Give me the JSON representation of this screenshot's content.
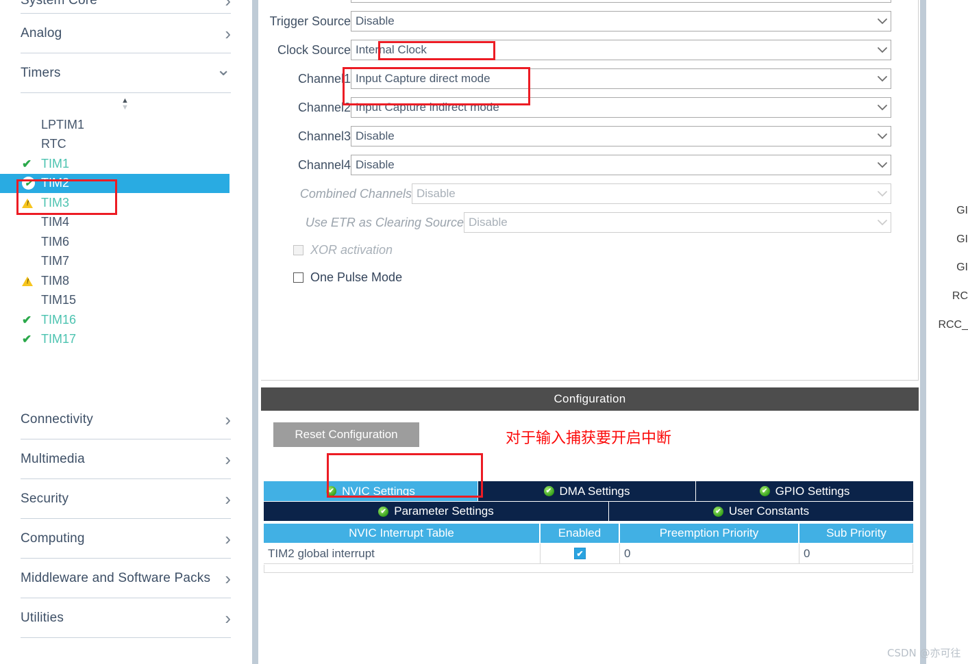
{
  "sidebar": {
    "categories_top": [
      {
        "label": "System Core",
        "icon": "chevron-right-icon",
        "expanded": false
      },
      {
        "label": "Analog",
        "icon": "chevron-right-icon",
        "expanded": false
      },
      {
        "label": "Timers",
        "icon": "chevron-down-icon",
        "expanded": true
      }
    ],
    "scroll_spinner": {
      "up": "▲",
      "down": "▼"
    },
    "timers": [
      {
        "label": "LPTIM1",
        "status": "none"
      },
      {
        "label": "RTC",
        "status": "none"
      },
      {
        "label": "TIM1",
        "status": "check"
      },
      {
        "label": "TIM2",
        "status": "circle-check",
        "selected": true
      },
      {
        "label": "TIM3",
        "status": "warning"
      },
      {
        "label": "TIM4",
        "status": "none"
      },
      {
        "label": "TIM6",
        "status": "none"
      },
      {
        "label": "TIM7",
        "status": "none"
      },
      {
        "label": "TIM8",
        "status": "warning"
      },
      {
        "label": "TIM15",
        "status": "none"
      },
      {
        "label": "TIM16",
        "status": "check"
      },
      {
        "label": "TIM17",
        "status": "check"
      }
    ],
    "categories_bottom": [
      {
        "label": "Connectivity",
        "icon": "chevron-right-icon"
      },
      {
        "label": "Multimedia",
        "icon": "chevron-right-icon"
      },
      {
        "label": "Security",
        "icon": "chevron-right-icon"
      },
      {
        "label": "Computing",
        "icon": "chevron-right-icon"
      },
      {
        "label": "Middleware and Software Packs",
        "icon": "chevron-right-icon"
      },
      {
        "label": "Utilities",
        "icon": "chevron-right-icon"
      }
    ]
  },
  "parameters": {
    "rows": [
      {
        "label": "Trigger Source",
        "value": "Disable",
        "disabled": false
      },
      {
        "label": "Clock Source",
        "value": "Internal Clock",
        "disabled": false
      },
      {
        "label": "Channel1",
        "value": "Input Capture direct mode",
        "disabled": false
      },
      {
        "label": "Channel2",
        "value": "Input Capture indirect mode",
        "disabled": false
      },
      {
        "label": "Channel3",
        "value": "Disable",
        "disabled": false
      },
      {
        "label": "Channel4",
        "value": "Disable",
        "disabled": false
      },
      {
        "label": "Combined Channels",
        "value": "Disable",
        "disabled": true
      },
      {
        "label": "Use ETR as Clearing Source",
        "value": "Disable",
        "disabled": true
      }
    ],
    "checkboxes": [
      {
        "label": "XOR activation",
        "checked": false,
        "disabled": true
      },
      {
        "label": "One Pulse Mode",
        "checked": false,
        "disabled": false
      }
    ]
  },
  "configuration": {
    "title": "Configuration",
    "reset_label": "Reset Configuration",
    "annotation_zh": "对于输入捕获要开启中断",
    "tabs_row1": [
      {
        "label": "NVIC Settings",
        "active": true
      },
      {
        "label": "DMA Settings",
        "active": false
      },
      {
        "label": "GPIO Settings",
        "active": false
      }
    ],
    "tabs_row2": [
      {
        "label": "Parameter Settings",
        "active": false
      },
      {
        "label": "User Constants",
        "active": false
      }
    ],
    "table": {
      "headers": [
        "NVIC Interrupt Table",
        "Enabled",
        "Preemption Priority",
        "Sub Priority"
      ],
      "rows": [
        {
          "name": "TIM2 global interrupt",
          "enabled": true,
          "preemption": "0",
          "sub": "0"
        }
      ]
    }
  },
  "pin_labels": [
    "GI",
    "GI",
    "GI",
    "RC",
    "RCC_"
  ],
  "watermark": "CSDN @亦可往",
  "colors": {
    "accent_blue": "#41b0e4",
    "tab_navy": "#0b2349",
    "selected_blue": "#29abe2",
    "annotation_red": "#ec1c24",
    "header_gray": "#4d4d4d",
    "ok_green": "#2aa84a",
    "warn_yellow": "#f7c51e"
  }
}
